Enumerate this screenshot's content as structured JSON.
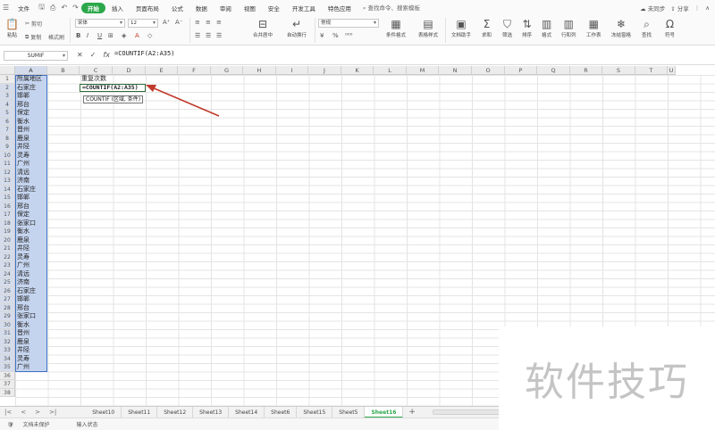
{
  "menu": {
    "file": "文件",
    "tabs": [
      "开始",
      "插入",
      "页面布局",
      "公式",
      "数据",
      "审阅",
      "视图",
      "安全",
      "开发工具",
      "特色应用"
    ],
    "active_tab": "开始",
    "search": "查找命令、搜索模板",
    "sync": "未同步",
    "share": "分享"
  },
  "ribbon": {
    "paste": "粘贴",
    "cut": "剪切",
    "copy": "复制",
    "format_painter": "格式刷",
    "font_name": "宋体",
    "font_size": "12",
    "merge_center": "合并居中",
    "wrap_text": "自动换行",
    "number_format": "常规",
    "conditional_format": "条件格式",
    "table_style": "表格样式",
    "doc_helper": "文档助手",
    "sum": "求和",
    "filter": "筛选",
    "sort": "排序",
    "format": "格式",
    "rowcol": "行和列",
    "worksheet": "工作表",
    "freeze": "冻结窗格",
    "find": "查找",
    "symbol": "符号"
  },
  "formula_bar": {
    "name_box": "SUMIF",
    "formula": "=COUNTIF(A2:A35)"
  },
  "columns": [
    "A",
    "B",
    "C",
    "D",
    "E",
    "F",
    "G",
    "H",
    "I",
    "J",
    "K",
    "L",
    "M",
    "N",
    "O",
    "P",
    "Q",
    "R",
    "S",
    "T",
    "U"
  ],
  "selected_column": "A",
  "rows": [
    "1",
    "2",
    "3",
    "4",
    "5",
    "6",
    "7",
    "8",
    "9",
    "10",
    "11",
    "12",
    "13",
    "14",
    "15",
    "16",
    "17",
    "18",
    "19",
    "20",
    "21",
    "22",
    "23",
    "24",
    "25",
    "26",
    "27",
    "28",
    "29",
    "30",
    "31",
    "32",
    "33",
    "34",
    "35",
    "36",
    "37",
    "38"
  ],
  "column_a": [
    "所属地区",
    "石家庄",
    "邯郸",
    "邢台",
    "保定",
    "衡水",
    "晋州",
    "鹿泉",
    "井陉",
    "灵寿",
    "广州",
    "清远",
    "济南",
    "石家庄",
    "邯郸",
    "邢台",
    "保定",
    "张家口",
    "衡水",
    "鹿泉",
    "井陉",
    "灵寿",
    "广州",
    "清远",
    "济南",
    "石家庄",
    "邯郸",
    "邢台",
    "张家口",
    "衡水",
    "晋州",
    "鹿泉",
    "井陉",
    "灵寿",
    "广州"
  ],
  "cell_c1": "重复次数",
  "cell_c2": "=COUNTIF(A2:A35)",
  "tooltip": "COUNTIF (区域, 条件)",
  "sheets": [
    "Sheet10",
    "Sheet11",
    "Sheet12",
    "Sheet13",
    "Sheet14",
    "Sheet6",
    "Sheet15",
    "Sheet5",
    "Sheet16"
  ],
  "active_sheet": "Sheet16",
  "status": {
    "protect": "文档未保护",
    "mode": "输入状态"
  },
  "watermark": "软件技巧",
  "colors": {
    "accent": "#2ca84a",
    "selection": "#c5d4ee",
    "selection_border": "#3f72c8",
    "arrow": "#c0392b"
  }
}
